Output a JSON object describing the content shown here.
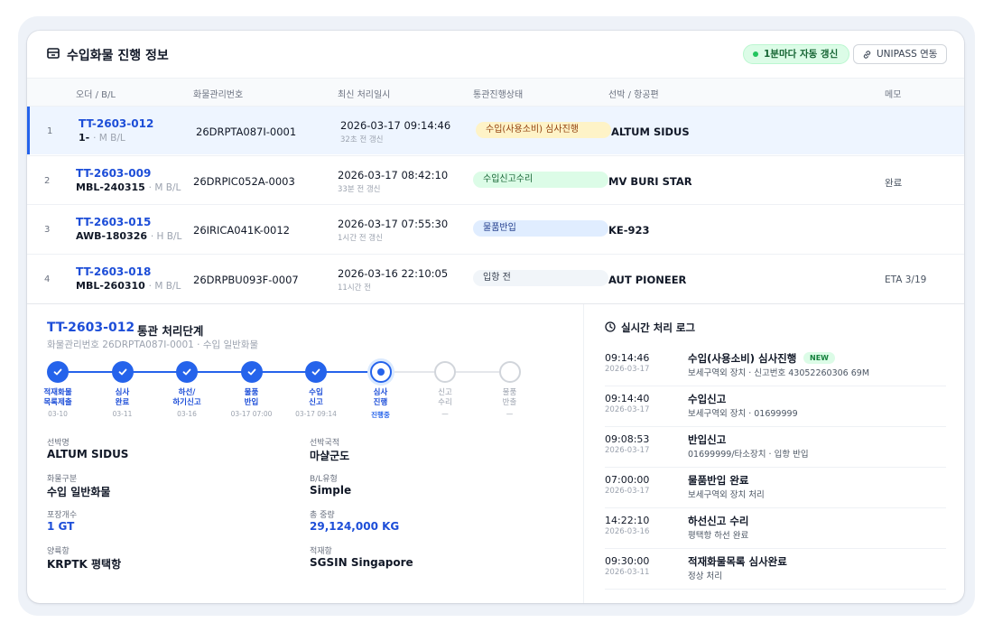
{
  "header": {
    "title": "수입화물 진행 정보",
    "auto_refresh_label": "1분마다 자동 갱신",
    "unipass_label": "UNIPASS 연동"
  },
  "table": {
    "columns": [
      "오더 / B/L",
      "화물관리번호",
      "최신 처리일시",
      "통관진행상태",
      "선박 / 항공편",
      "메모"
    ],
    "rows": [
      {
        "index": "1",
        "order": "TT-2603-012",
        "bl": "1-",
        "bl_type": "· M B/L",
        "mgmt_no": "26DRPTA087I-0001",
        "datetime": "2026-03-17 09:14:46",
        "ago": "32초 전 갱신",
        "status": "수입(사용소비) 심사진행",
        "status_bg": "#fef3c7",
        "status_fg": "#92400e",
        "vessel": "ALTUM SIDUS",
        "memo": "",
        "selected": true
      },
      {
        "index": "2",
        "order": "TT-2603-009",
        "bl": "MBL-240315",
        "bl_type": "· M B/L",
        "mgmt_no": "26DRPIC052A-0003",
        "datetime": "2026-03-17 08:42:10",
        "ago": "33분 전 갱신",
        "status": "수입신고수리",
        "status_bg": "#dcfce7",
        "status_fg": "#166534",
        "vessel": "MV BURI STAR",
        "memo": "완료",
        "selected": false
      },
      {
        "index": "3",
        "order": "TT-2603-015",
        "bl": "AWB-180326",
        "bl_type": "· H B/L",
        "mgmt_no": "26IRICA041K-0012",
        "datetime": "2026-03-17 07:55:30",
        "ago": "1시간 전 갱신",
        "status": "물품반입",
        "status_bg": "#e0edff",
        "status_fg": "#1e3a8a",
        "vessel": "KE-923",
        "memo": "",
        "selected": false
      },
      {
        "index": "4",
        "order": "TT-2603-018",
        "bl": "MBL-260310",
        "bl_type": "· M B/L",
        "mgmt_no": "26DRPBU093F-0007",
        "datetime": "2026-03-16 22:10:05",
        "ago": "11시간 전",
        "status": "입항 전",
        "status_bg": "#f1f5f9",
        "status_fg": "#374151",
        "vessel": "AUT PIONEER",
        "memo": "ETA 3/19",
        "selected": false
      }
    ]
  },
  "detail": {
    "order": "TT-2603-012",
    "title": "통관 처리단계",
    "subtitle": "화물관리번호 26DRPTA087I-0001 · 수입 일반화물",
    "steps": [
      {
        "label": "적재화물\n목록제출",
        "date": "03-10",
        "state": "done"
      },
      {
        "label": "심사\n완료",
        "date": "03-11",
        "state": "done"
      },
      {
        "label": "하선/\n하기신고",
        "date": "03-16",
        "state": "done"
      },
      {
        "label": "물품\n반입",
        "date": "03-17 07:00",
        "state": "done"
      },
      {
        "label": "수입\n신고",
        "date": "03-17 09:14",
        "state": "done"
      },
      {
        "label": "심사\n진행",
        "date": "진행중",
        "state": "current"
      },
      {
        "label": "신고\n수리",
        "date": "—",
        "state": "pending"
      },
      {
        "label": "물품\n반출",
        "date": "—",
        "state": "pending"
      }
    ],
    "fields": [
      {
        "label": "선박명",
        "value": "ALTUM SIDUS",
        "accent": false
      },
      {
        "label": "선박국적",
        "value": "마샬군도",
        "accent": false
      },
      {
        "label": "화물구분",
        "value": "수입 일반화물",
        "accent": false
      },
      {
        "label": "B/L유형",
        "value": "Simple",
        "accent": false
      },
      {
        "label": "포장개수",
        "value": "1 GT",
        "accent": true
      },
      {
        "label": "총 중량",
        "value": "29,124,000 KG",
        "accent": true
      },
      {
        "label": "양륙항",
        "value": "KRPTK 평택항",
        "accent": false
      },
      {
        "label": "적재항",
        "value": "SGSIN Singapore",
        "accent": false
      }
    ]
  },
  "log": {
    "title": "실시간 처리 로그",
    "new_label": "NEW",
    "items": [
      {
        "time": "09:14:46",
        "date": "2026-03-17",
        "event": "수입(사용소비) 심사진행",
        "desc": "보세구역외 장치 · 신고번호 43052260306 69M",
        "is_new": true
      },
      {
        "time": "09:14:40",
        "date": "2026-03-17",
        "event": "수입신고",
        "desc": "보세구역외 장치 · 01699999",
        "is_new": false
      },
      {
        "time": "09:08:53",
        "date": "2026-03-17",
        "event": "반입신고",
        "desc": "01699999/타소장치 · 입항 반입",
        "is_new": false
      },
      {
        "time": "07:00:00",
        "date": "2026-03-17",
        "event": "물품반입 완료",
        "desc": "보세구역외 장치 처리",
        "is_new": false
      },
      {
        "time": "14:22:10",
        "date": "2026-03-16",
        "event": "하선신고 수리",
        "desc": "평택항 하선 완료",
        "is_new": false
      },
      {
        "time": "09:30:00",
        "date": "2026-03-11",
        "event": "적재화물목록 심사완료",
        "desc": "정상 처리",
        "is_new": false
      }
    ]
  }
}
